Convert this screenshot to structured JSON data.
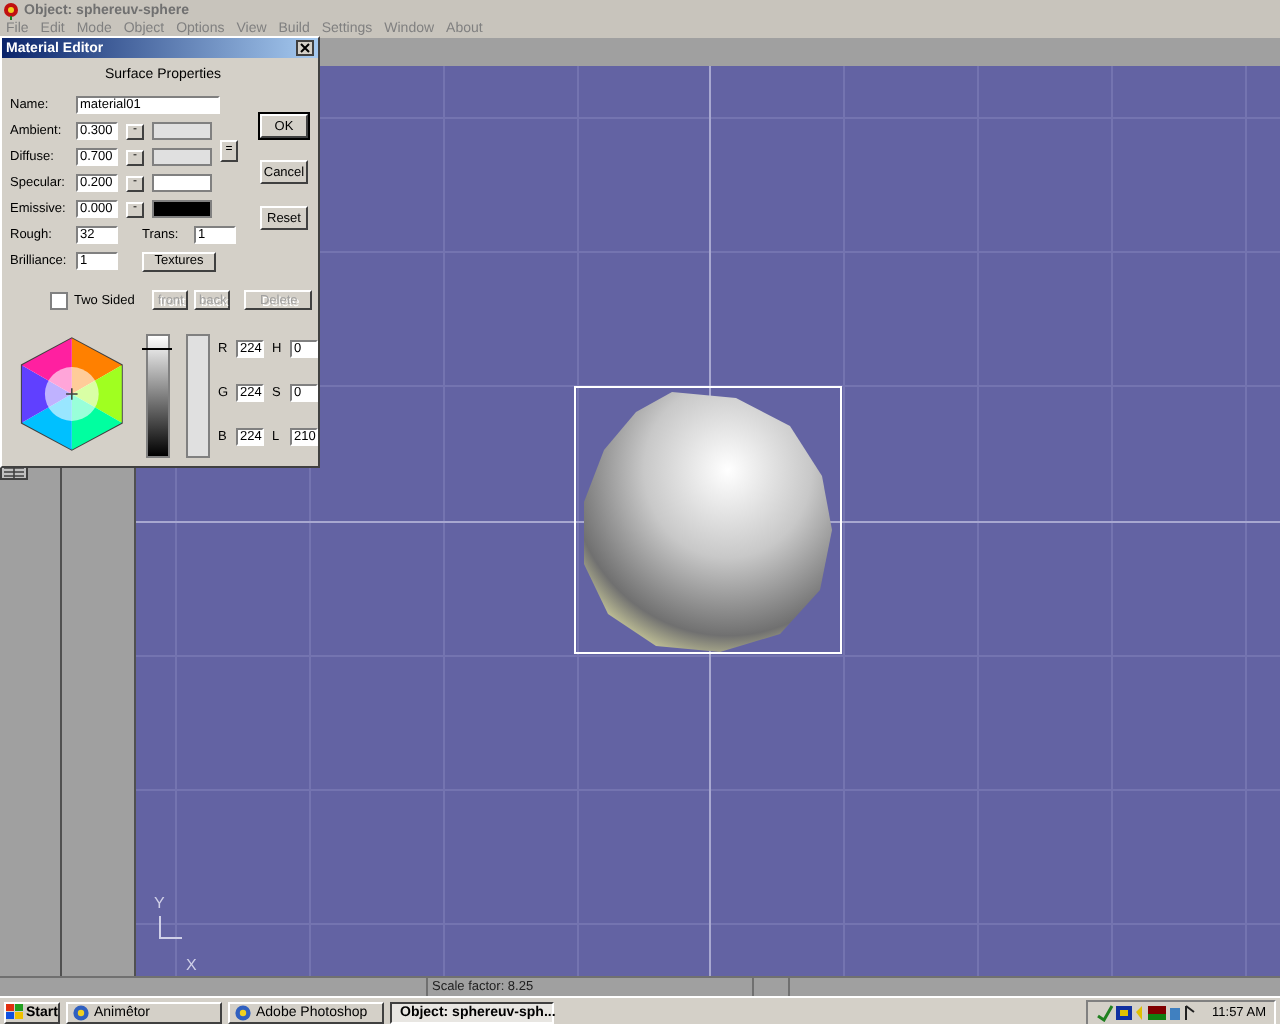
{
  "window": {
    "title": "Object: sphereuv-sphere"
  },
  "menu": [
    "File",
    "Edit",
    "Mode",
    "Object",
    "Options",
    "View",
    "Build",
    "Settings",
    "Window",
    "About"
  ],
  "material_editor": {
    "title": "Material Editor",
    "heading": "Surface Properties",
    "name_label": "Name:",
    "name_value": "material01",
    "properties": [
      {
        "label": "Ambient:",
        "value": "0.300",
        "button": "-",
        "color": "#e0e0e0"
      },
      {
        "label": "Diffuse:",
        "value": "0.700",
        "button": "-",
        "color": "#e0e0e0"
      },
      {
        "label": "Specular:",
        "value": "0.200",
        "button": "-",
        "color": "#ffffff"
      },
      {
        "label": "Emissive:",
        "value": "0.000",
        "button": "-",
        "color": "#000000"
      }
    ],
    "link_button": "=",
    "rough_label": "Rough:",
    "rough_value": "32",
    "trans_label": "Trans:",
    "trans_value": "1",
    "brilliance_label": "Brilliance:",
    "brilliance_value": "1",
    "textures_button": "Textures",
    "buttons": [
      "OK",
      "Cancel",
      "Reset"
    ],
    "two_sided": {
      "label": "Two Sided",
      "checked": false
    },
    "side_buttons": [
      {
        "label": "front",
        "disabled": true
      },
      {
        "label": "back",
        "disabled": true
      },
      {
        "label": "Delete",
        "disabled": true
      }
    ],
    "color_fields": [
      {
        "label": "R",
        "value": "224"
      },
      {
        "label": "H",
        "value": "0"
      },
      {
        "label": "G",
        "value": "224"
      },
      {
        "label": "S",
        "value": "0"
      },
      {
        "label": "B",
        "value": "224"
      },
      {
        "label": "L",
        "value": "210"
      }
    ],
    "lightness": {
      "level": 0.12
    }
  },
  "viewport": {
    "axis_y": "Y",
    "axis_x": "X"
  },
  "status_bar": {
    "scale": "Scale factor: 8.25"
  },
  "taskbar": {
    "start": "Start",
    "tasks": [
      {
        "label": "Animêtor",
        "selected": false
      },
      {
        "label": "Adobe Photoshop",
        "selected": false
      },
      {
        "label": "Object: sphereuv-sph...",
        "selected": true
      }
    ],
    "clock": "11:57 AM"
  }
}
